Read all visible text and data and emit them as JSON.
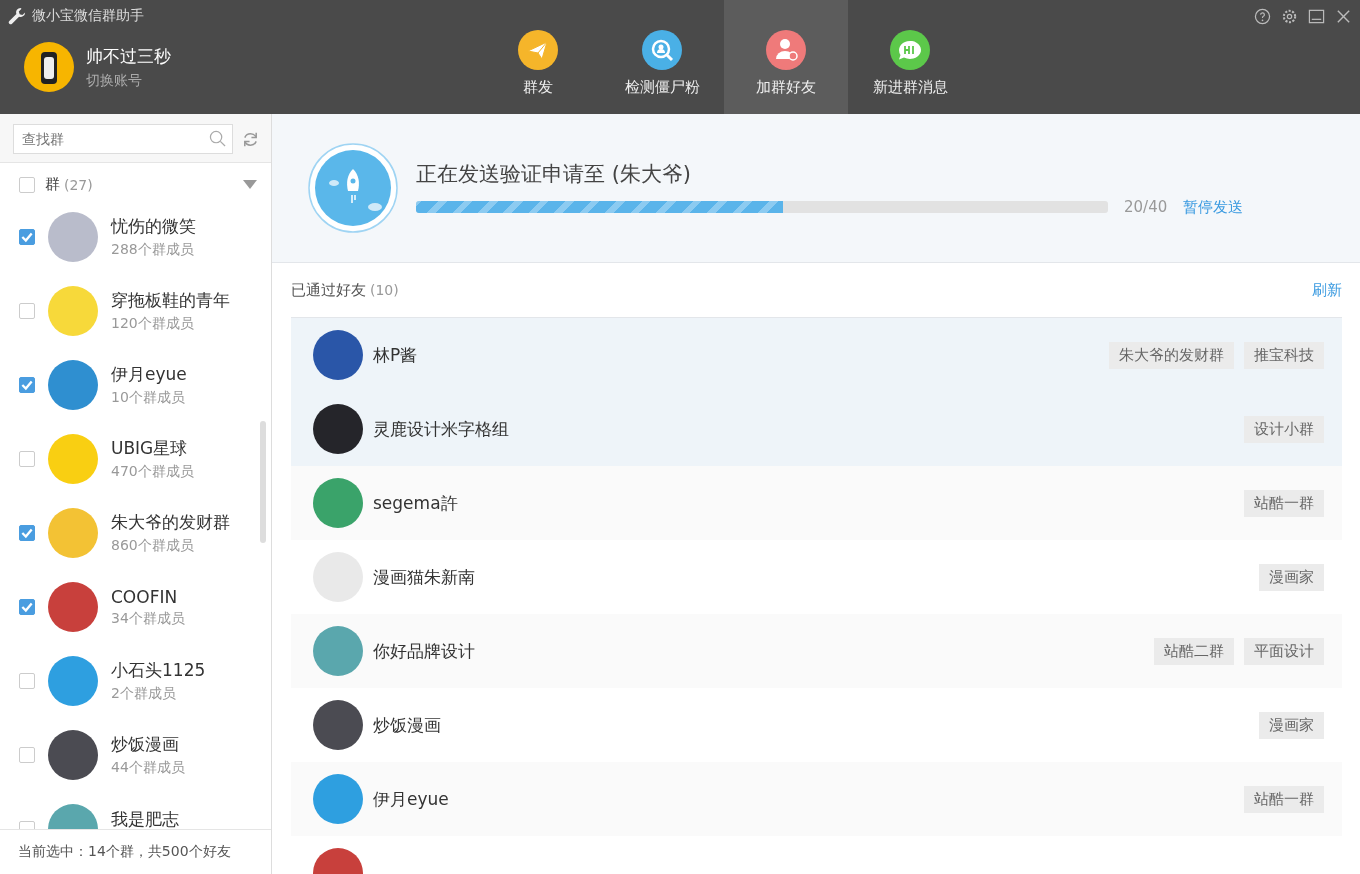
{
  "window": {
    "title": "微小宝微信群助手"
  },
  "account": {
    "name": "帅不过三秒",
    "switch_label": "切换账号"
  },
  "tabs": [
    {
      "label": "群发",
      "kind": "send",
      "selected": false
    },
    {
      "label": "检测僵尸粉",
      "kind": "detect",
      "selected": false
    },
    {
      "label": "加群好友",
      "kind": "add",
      "selected": true
    },
    {
      "label": "新进群消息",
      "kind": "message",
      "selected": false
    }
  ],
  "sidebar": {
    "search": {
      "placeholder": "查找群"
    },
    "group_header": {
      "label": "群",
      "count": "(27)",
      "checked": false,
      "expanded": true
    },
    "groups": [
      {
        "name": "忧伤的微笑",
        "members": "288个群成员",
        "checked": true,
        "color": "#b9bccb"
      },
      {
        "name": "穿拖板鞋的青年",
        "members": "120个群成员",
        "checked": false,
        "color": "#f7d93a"
      },
      {
        "name": "伊月eyue",
        "members": "10个群成员",
        "checked": true,
        "color": "#2f8fd0"
      },
      {
        "name": "UBIG星球",
        "members": "470个群成员",
        "checked": false,
        "color": "#f9cf12"
      },
      {
        "name": "朱大爷的发财群",
        "members": "860个群成员",
        "checked": true,
        "color": "#f3c234"
      },
      {
        "name": "COOFIN",
        "members": "34个群成员",
        "checked": true,
        "color": "#c8403c"
      },
      {
        "name": "小石头1125",
        "members": "2个群成员",
        "checked": false,
        "color": "#2e9fe0"
      },
      {
        "name": "炒饭漫画",
        "members": "44个群成员",
        "checked": false,
        "color": "#4b4b52"
      },
      {
        "name": "我是肥志",
        "checked": false,
        "color": "#5aa7ad"
      }
    ],
    "footer": "当前选中：14个群，共500个好友"
  },
  "progress": {
    "title": "正在发送验证申请至 (朱大爷)",
    "level": 0.53,
    "reading": "20/40",
    "pause_link": "暂停发送"
  },
  "friends": {
    "title": "已通过好友",
    "count": "(10)",
    "refresh_link": "刷新",
    "rows": [
      {
        "name": "林P酱",
        "tags": [
          "朱大爷的发财群",
          "推宝科技"
        ],
        "selected": true,
        "color": "#2a56a8"
      },
      {
        "name": "灵鹿设计米字格组",
        "tags": [
          "设计小群"
        ],
        "selected": true,
        "color": "#25252a"
      },
      {
        "name": "segema許",
        "tags": [
          "站酷一群"
        ],
        "selected": false,
        "color": "#3aa36a"
      },
      {
        "name": "漫画猫朱新南",
        "tags": [
          "漫画家"
        ],
        "selected": false,
        "color": "#e9e9e9"
      },
      {
        "name": "你好品牌设计",
        "tags": [
          "站酷二群",
          "平面设计"
        ],
        "selected": false,
        "color": "#5aa7ad"
      },
      {
        "name": "炒饭漫画",
        "tags": [
          "漫画家"
        ],
        "selected": false,
        "color": "#4b4b52"
      },
      {
        "name": "伊月eyue",
        "tags": [
          "站酷一群"
        ],
        "selected": false,
        "color": "#2e9fe0"
      },
      {
        "selected": false,
        "color": "#c8403c"
      }
    ]
  }
}
